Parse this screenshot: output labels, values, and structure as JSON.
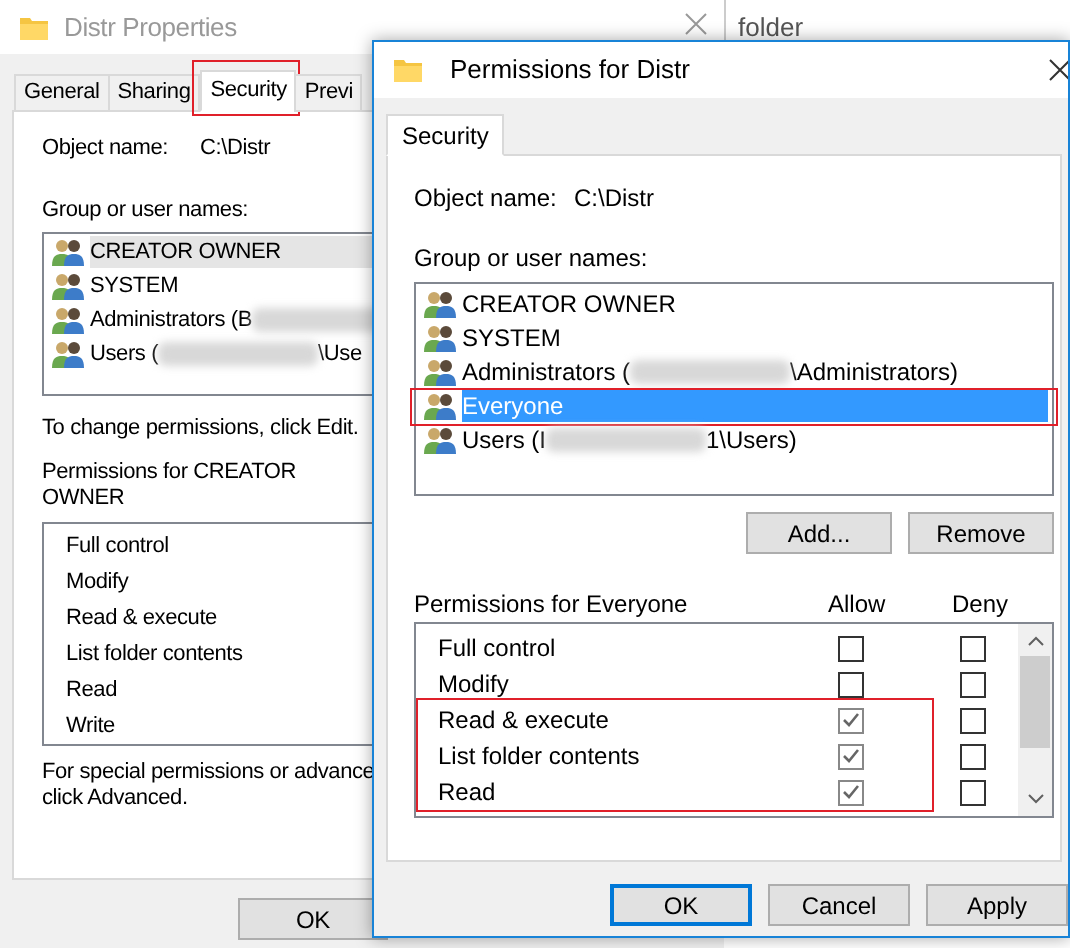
{
  "background_window": {
    "title": "folder"
  },
  "properties_window": {
    "title": "Distr Properties",
    "tabs": [
      {
        "label": "General",
        "selected": false,
        "highlighted": false
      },
      {
        "label": "Sharing",
        "selected": false,
        "highlighted": false
      },
      {
        "label": "Security",
        "selected": true,
        "highlighted": true
      },
      {
        "label": "Previ",
        "selected": false,
        "highlighted": false
      }
    ],
    "object_label": "Object name:",
    "object_value": "C:\\Distr",
    "group_label": "Group or user names:",
    "users": [
      {
        "name": "CREATOR OWNER",
        "selected": true,
        "redacted": false
      },
      {
        "name": "SYSTEM",
        "selected": false,
        "redacted": false
      },
      {
        "name": "Administrators (B",
        "selected": false,
        "redacted": true
      },
      {
        "name": "Users (",
        "name_end": "\\Use",
        "selected": false,
        "redacted": true
      }
    ],
    "edit_hint": "To change permissions, click Edit.",
    "permissions_label": "Permissions for CREATOR OWNER",
    "permissions": [
      "Full control",
      "Modify",
      "Read & execute",
      "List folder contents",
      "Read",
      "Write"
    ],
    "advanced_hint": [
      "For special permissions or advance",
      "click Advanced."
    ],
    "buttons": [
      "OK"
    ]
  },
  "permissions_dialog": {
    "title": "Permissions for Distr",
    "tabs": [
      {
        "label": "Security",
        "selected": true
      }
    ],
    "object_label": "Object name:",
    "object_value": "C:\\Distr",
    "group_label": "Group or user names:",
    "users": [
      {
        "name": "CREATOR OWNER",
        "selected": false,
        "highlighted": false,
        "redacted": false
      },
      {
        "name": "SYSTEM",
        "selected": false,
        "highlighted": false,
        "redacted": false
      },
      {
        "name": "Administrators (",
        "name_end": "\\Administrators)",
        "selected": false,
        "highlighted": false,
        "redacted": true
      },
      {
        "name": "Everyone",
        "selected": true,
        "highlighted": true,
        "redacted": false
      },
      {
        "name": "Users (I",
        "name_end": "1\\Users)",
        "selected": false,
        "highlighted": false,
        "redacted": true
      }
    ],
    "user_buttons": [
      "Add...",
      "Remove"
    ],
    "permissions_label": "Permissions for Everyone",
    "allow_label": "Allow",
    "deny_label": "Deny",
    "permissions": [
      {
        "name": "Full control",
        "allow": false,
        "deny": false,
        "highlighted": false
      },
      {
        "name": "Modify",
        "allow": false,
        "deny": false,
        "highlighted": false
      },
      {
        "name": "Read & execute",
        "allow": true,
        "deny": false,
        "highlighted": true
      },
      {
        "name": "List folder contents",
        "allow": true,
        "deny": false,
        "highlighted": true
      },
      {
        "name": "Read",
        "allow": true,
        "deny": false,
        "highlighted": true
      }
    ],
    "buttons": [
      {
        "label": "OK",
        "default": true
      },
      {
        "label": "Cancel",
        "default": false
      },
      {
        "label": "Apply",
        "default": false
      }
    ]
  }
}
